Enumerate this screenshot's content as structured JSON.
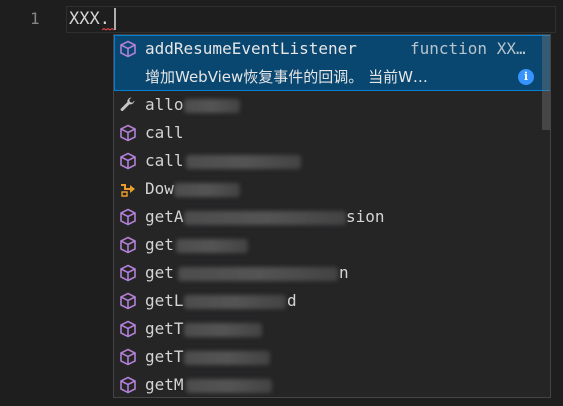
{
  "editor": {
    "line_number": "1",
    "code": "XXX.",
    "colors": {
      "background": "#1e1e1e",
      "method_icon": "#b180d7",
      "wrench_icon": "#c5c5c5",
      "event_icon": "#ee9d28",
      "info": "#3794ff",
      "selection": "#094771"
    }
  },
  "suggest": {
    "focused": {
      "icon": "method-cube-icon",
      "label": "addResumeEventListener",
      "detail": "function XX…",
      "doc": "增加WebView恢复事件的回调。 当前W…",
      "info_glyph": "i"
    },
    "items": [
      {
        "icon": "wrench-icon",
        "label": "allo"
      },
      {
        "icon": "method-cube-icon",
        "label": "call"
      },
      {
        "icon": "method-cube-icon",
        "label": "call"
      },
      {
        "icon": "event-icon",
        "label": "Dow"
      },
      {
        "icon": "method-cube-icon",
        "label": "getA",
        "suffix": "sion"
      },
      {
        "icon": "method-cube-icon",
        "label": "get"
      },
      {
        "icon": "method-cube-icon",
        "label": "get",
        "suffix": "n"
      },
      {
        "icon": "method-cube-icon",
        "label": "getL",
        "suffix": "d"
      },
      {
        "icon": "method-cube-icon",
        "label": "getT"
      },
      {
        "icon": "method-cube-icon",
        "label": "getT"
      },
      {
        "icon": "method-cube-icon",
        "label": "getM"
      }
    ]
  }
}
